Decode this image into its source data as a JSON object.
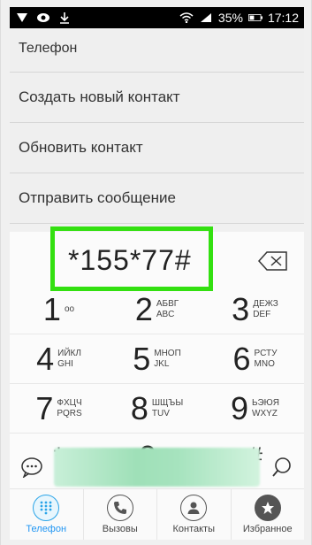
{
  "status_bar": {
    "battery": "35%",
    "time": "17:12"
  },
  "menu": {
    "title": "Телефон",
    "items": [
      {
        "label": "Создать новый контакт"
      },
      {
        "label": "Обновить контакт"
      },
      {
        "label": "Отправить сообщение"
      }
    ]
  },
  "dialer": {
    "number": "*155*77#",
    "keys": [
      {
        "digit": "1",
        "letters": [
          "",
          "oo"
        ]
      },
      {
        "digit": "2",
        "letters": [
          "АБВГ",
          "ABC"
        ]
      },
      {
        "digit": "3",
        "letters": [
          "ДЕЖЗ",
          "DEF"
        ]
      },
      {
        "digit": "4",
        "letters": [
          "ИЙКЛ",
          "GHI"
        ]
      },
      {
        "digit": "5",
        "letters": [
          "МНОП",
          "JKL"
        ]
      },
      {
        "digit": "6",
        "letters": [
          "РСТУ",
          "MNO"
        ]
      },
      {
        "digit": "7",
        "letters": [
          "ФХЦЧ",
          "PQRS"
        ]
      },
      {
        "digit": "8",
        "letters": [
          "ШЩЪЫ",
          "TUV"
        ]
      },
      {
        "digit": "9",
        "letters": [
          "ЬЭЮЯ",
          "WXYZ"
        ]
      },
      {
        "digit": "*",
        "letters": []
      },
      {
        "digit": "0",
        "letters": [
          "+"
        ]
      },
      {
        "digit": "#",
        "letters": []
      }
    ]
  },
  "nav": {
    "items": [
      {
        "label": "Телефон",
        "icon": "dialpad-icon",
        "active": true
      },
      {
        "label": "Вызовы",
        "icon": "phone-icon",
        "active": false
      },
      {
        "label": "Контакты",
        "icon": "contact-icon",
        "active": false
      },
      {
        "label": "Избранное",
        "icon": "star-icon",
        "active": false
      }
    ]
  },
  "colors": {
    "highlight": "#33e010",
    "active": "#2196f3"
  }
}
